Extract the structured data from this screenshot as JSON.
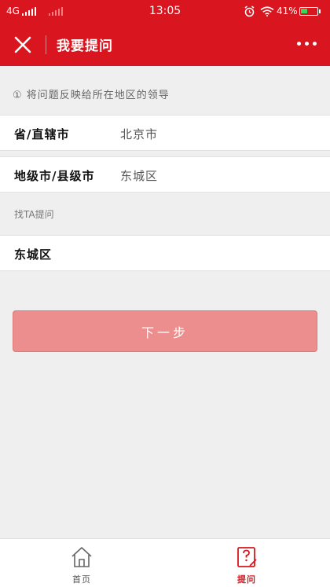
{
  "status_bar": {
    "network": "4G",
    "time": "13:05",
    "battery": "41%",
    "battery_level": 0.41
  },
  "nav": {
    "title": "我要提问"
  },
  "hint": "① 将问题反映给所在地区的领导",
  "form": {
    "province_label": "省/直辖市",
    "province_value": "北京市",
    "city_label": "地级市/县级市",
    "city_value": "东城区",
    "target_section_label": "找TA提问",
    "target_value": "东城区"
  },
  "next_button": "下一步",
  "tabbar": {
    "items": [
      {
        "label": "首页",
        "icon": "home-icon",
        "active": false
      },
      {
        "label": "提问",
        "icon": "ask-icon",
        "active": true
      }
    ]
  },
  "colors": {
    "brand_red": "#d9161f",
    "button_disabled": "#ec8e8d"
  }
}
